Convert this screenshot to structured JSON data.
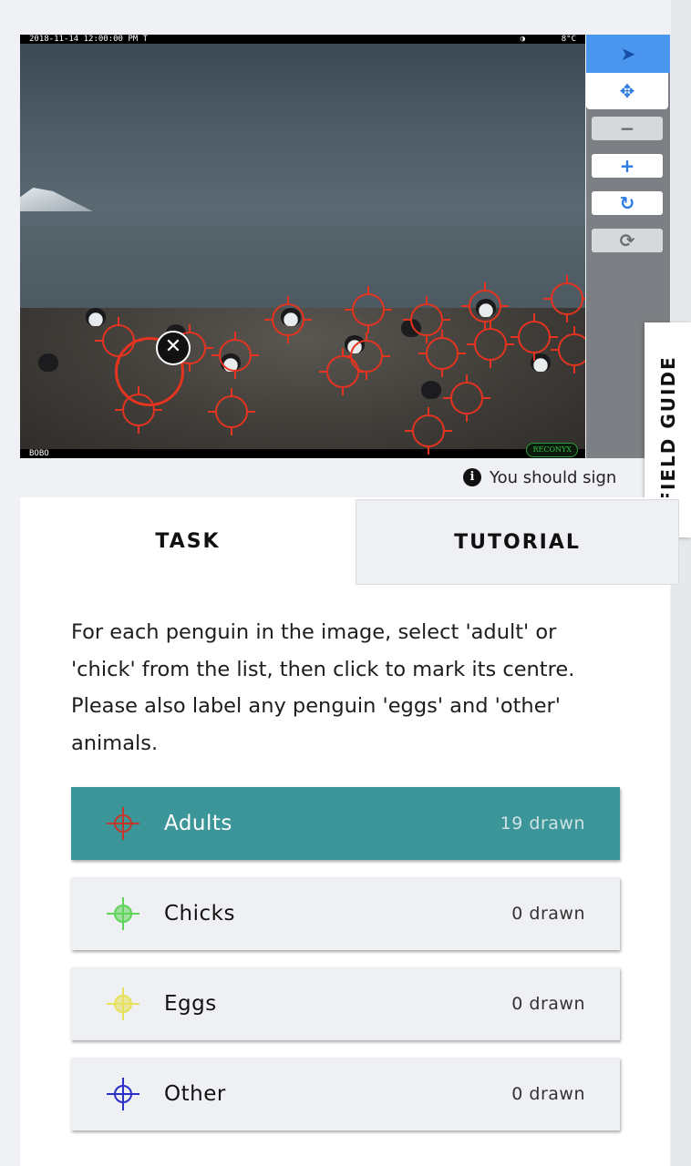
{
  "camera": {
    "timestamp": "2018-11-14 12:00:00 PM  T",
    "moon_icon": "moon-phase-icon",
    "temperature": "8°C",
    "camera_id": "BOBO",
    "brand": "RECONYX"
  },
  "toolbar": {
    "tools": [
      {
        "name": "pointer-tool",
        "icon": "cursor-arrow-icon",
        "glyph": "➤"
      },
      {
        "name": "move-tool",
        "icon": "move-arrows-icon",
        "glyph": "✥"
      },
      {
        "name": "zoom-out-tool",
        "icon": "minus-icon",
        "glyph": "−"
      },
      {
        "name": "zoom-in-tool",
        "icon": "plus-icon",
        "glyph": "+"
      },
      {
        "name": "rotate-tool",
        "icon": "rotate-icon",
        "glyph": "↻"
      },
      {
        "name": "reset-tool",
        "icon": "refresh-icon",
        "glyph": "⟳"
      }
    ]
  },
  "annotations": {
    "marker_color": "#e43420",
    "delete_glyph": "✕",
    "count": 19
  },
  "field_guide": {
    "label": "FIELD GUIDE"
  },
  "notice": {
    "icon": "info-icon",
    "glyph": "i",
    "text": "You should sign"
  },
  "tabs": {
    "task": "TASK",
    "tutorial": "TUTORIAL"
  },
  "task": {
    "instructions": "For each penguin in the image, select 'adult' or 'chick' from the list, then click to mark its centre. Please also label any penguin 'eggs' and 'other' animals.",
    "options": [
      {
        "label": "Adults",
        "count": "19 drawn",
        "color": "#c2382a",
        "selected": true
      },
      {
        "label": "Chicks",
        "count": "0 drawn",
        "color": "#5fd35a",
        "selected": false
      },
      {
        "label": "Eggs",
        "count": "0 drawn",
        "color": "#e6e05a",
        "selected": false
      },
      {
        "label": "Other",
        "count": "0 drawn",
        "color": "#2a2fc8",
        "selected": false
      }
    ]
  }
}
